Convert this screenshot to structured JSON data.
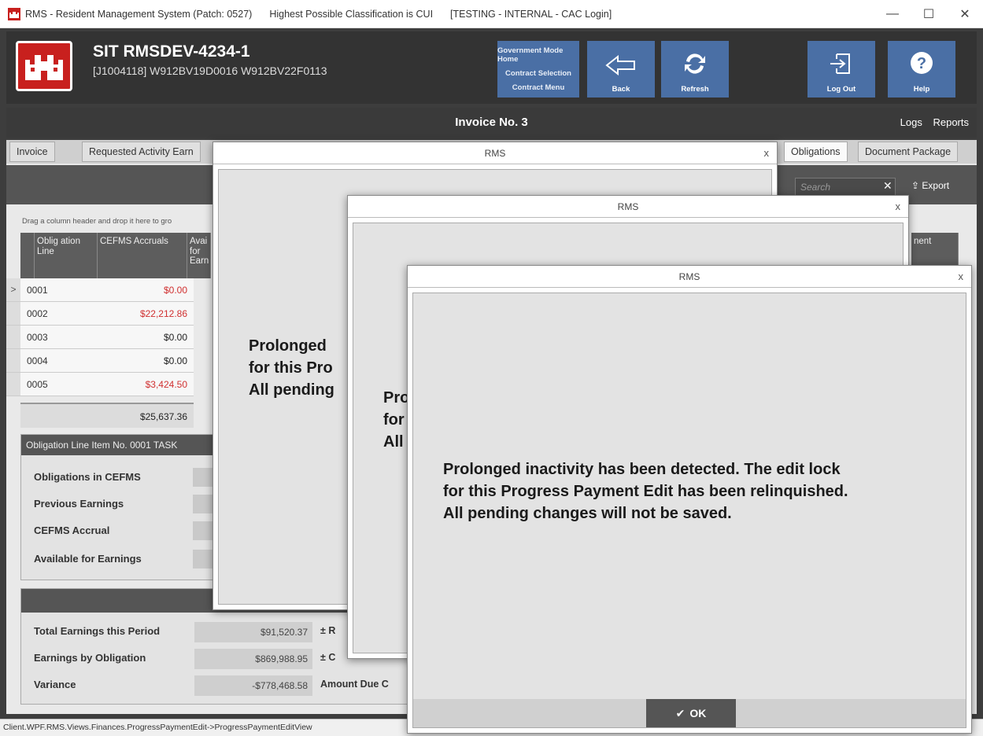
{
  "window": {
    "title_app": "RMS - Resident Management System (Patch: 0527)",
    "classification": "Highest Possible Classification is CUI",
    "mode": "[TESTING - INTERNAL - CAC Login]"
  },
  "header": {
    "project_title": "SIT RMSDEV-4234-1",
    "project_sub": "[J1004118] W912BV19D0016  W912BV22F0113",
    "gov_menu": [
      "Government Mode Home",
      "Contract Selection",
      "Contract Menu"
    ],
    "buttons": {
      "back": "Back",
      "refresh": "Refresh",
      "logout": "Log Out",
      "help": "Help"
    }
  },
  "strip": {
    "title": "Invoice No. 3",
    "links": [
      "Logs",
      "Reports"
    ]
  },
  "tabs": {
    "invoice": "Invoice",
    "requested": "Requested Activity Earn",
    "obligations": "Obligations",
    "document_package": "Document Package"
  },
  "toolbar": {
    "search_placeholder": "Search",
    "export": "Export"
  },
  "grid": {
    "group_hint": "Drag a column header and drop it here to gro",
    "columns": [
      "Oblig ation Line",
      "CEFMS Accruals",
      "Avai for Earn",
      "nent"
    ],
    "rows": [
      {
        "line": "0001",
        "accrual": "$0.00",
        "red": true,
        "selected": true
      },
      {
        "line": "0002",
        "accrual": "$22,212.86",
        "red": true
      },
      {
        "line": "0003",
        "accrual": "$0.00",
        "red": false
      },
      {
        "line": "0004",
        "accrual": "$0.00",
        "red": false
      },
      {
        "line": "0005",
        "accrual": "$3,424.50",
        "red": true
      }
    ],
    "total": "$25,637.36"
  },
  "obligation_item": {
    "header": "Obligation Line Item No. 0001 TASK",
    "labels": [
      "Obligations in CEFMS",
      "Previous Earnings",
      "CEFMS Accrual",
      "Available for Earnings"
    ]
  },
  "summary": {
    "rows": [
      {
        "label": "Total Earnings this Period",
        "value": "$91,520.37",
        "right": "± R"
      },
      {
        "label": "Earnings by Obligation",
        "value": "$869,988.95",
        "right": "± C"
      },
      {
        "label": "Variance",
        "value": "-$778,468.58",
        "right": "Amount Due C"
      }
    ]
  },
  "dialogs": {
    "title": "RMS",
    "close": "x",
    "message_lines": [
      "Prolonged inactivity has been detected. The edit lock",
      "for this Progress Payment Edit has been relinquished.",
      "All pending changes will not be saved."
    ],
    "d1_lines": [
      "Prolonged",
      "for this Pro",
      "All pending"
    ],
    "d2_lines": [
      "Pro",
      "for",
      "All"
    ],
    "ok": "OK"
  },
  "statusbar": "Client.WPF.RMS.Views.Finances.ProgressPaymentEdit->ProgressPaymentEditView",
  "colors": {
    "accent": "#4a6fa5",
    "logo_red": "#c8201e",
    "negative": "#d03030"
  }
}
